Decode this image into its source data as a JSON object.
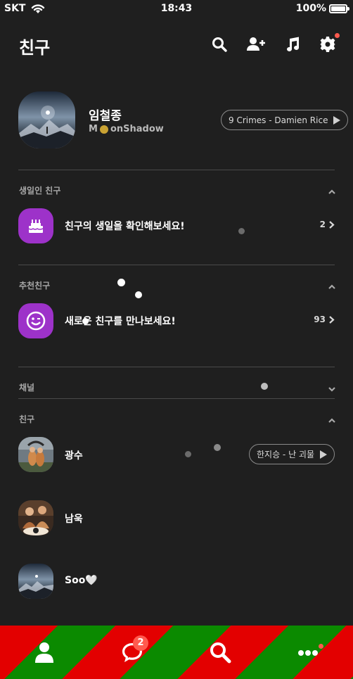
{
  "status_bar": {
    "carrier": "SKT",
    "time": "18:43",
    "battery": "100%"
  },
  "header": {
    "title": "친구",
    "icons": [
      "search-icon",
      "add-friend-icon",
      "music-note-icon",
      "settings-gear-icon"
    ]
  },
  "profile": {
    "name": "임철종",
    "status_before": "M",
    "status_after": "onShadow",
    "music": "9 Crimes - Damien Rice"
  },
  "sections": {
    "birthday": {
      "label": "생일인 친구",
      "row_text": "친구의 생일을 확인해보세요!",
      "count": "2"
    },
    "recommended": {
      "label": "추천친구",
      "row_text": "새로운 친구를 만나보세요!",
      "count": "93"
    },
    "channel": {
      "label": "채널"
    },
    "friends": {
      "label": "친구"
    }
  },
  "friends": [
    {
      "name": "광수",
      "music": "한지승 - 난 괴물"
    },
    {
      "name": "남욱"
    },
    {
      "name": "Soo🤍"
    }
  ],
  "bottom_nav": {
    "items": [
      "friends-icon",
      "chat-icon",
      "search-icon",
      "more-icon"
    ],
    "chat_badge": "2"
  },
  "colors": {
    "background": "#1f1f1f",
    "accent_purple": "#9d32c9",
    "badge_red": "#ff5a4e",
    "nav_red": "#e30000",
    "nav_green": "#0b8a00"
  }
}
